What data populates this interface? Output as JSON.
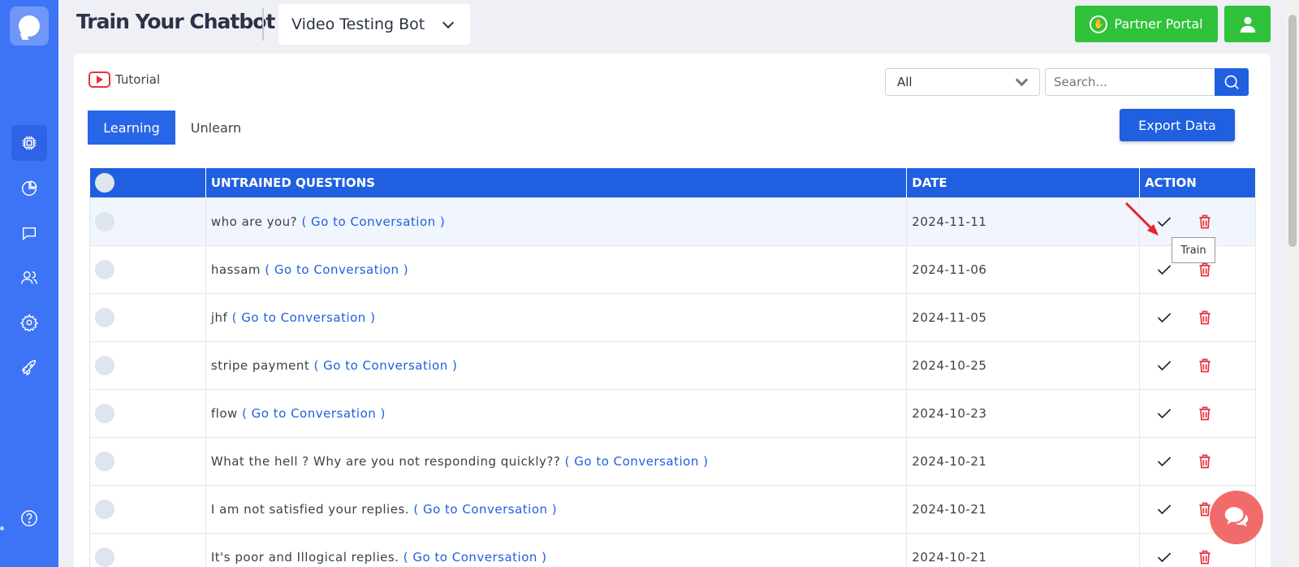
{
  "header": {
    "title": "Train Your Chatbot",
    "bot_name": "Video Testing Bot",
    "partner_label": "Partner Portal"
  },
  "toolbar": {
    "tutorial_label": "Tutorial",
    "filter_value": "All",
    "search_placeholder": "Search...",
    "export_label": "Export Data"
  },
  "tabs": [
    {
      "label": "Learning",
      "active": true
    },
    {
      "label": "Unlearn",
      "active": false
    }
  ],
  "table": {
    "headers": [
      "UNTRAINED QUESTIONS",
      "DATE",
      "ACTION"
    ],
    "link_text": "( Go to Conversation )",
    "rows": [
      {
        "question": "who are you?",
        "date": "2024-11-11"
      },
      {
        "question": "hassam",
        "date": "2024-11-06"
      },
      {
        "question": "jhf",
        "date": "2024-11-05"
      },
      {
        "question": "stripe payment",
        "date": "2024-10-25"
      },
      {
        "question": "flow",
        "date": "2024-10-23"
      },
      {
        "question": "What the hell ? Why are you not responding quickly??",
        "date": "2024-10-21"
      },
      {
        "question": "I am not satisfied your replies.",
        "date": "2024-10-21"
      },
      {
        "question": "It's poor and Illogical replies.",
        "date": "2024-10-21"
      }
    ]
  },
  "tooltip": "Train",
  "colors": {
    "sidebar": "#3d73f5",
    "primary": "#1f5fe0",
    "partner": "#2fc23a",
    "danger": "#e8333a",
    "chat_fab": "#f26b6b"
  },
  "sidebar_icons": [
    "chip-icon",
    "pie-chart-icon",
    "chat-icon",
    "users-icon",
    "gear-icon",
    "rocket-icon",
    "help-icon"
  ]
}
